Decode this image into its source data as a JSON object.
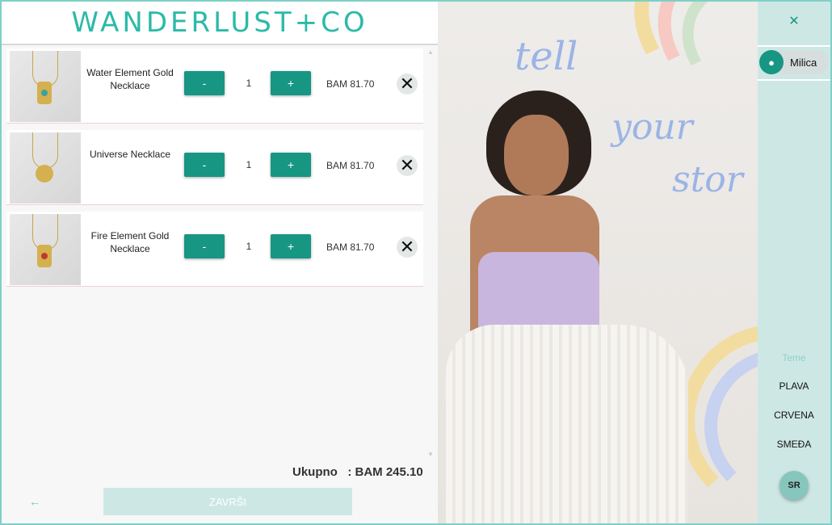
{
  "header": {
    "logo": "WANDERLUST+CO"
  },
  "cart": {
    "items": [
      {
        "name": "Water Element Gold Necklace",
        "quantity": "1",
        "price": "BAM 81.70",
        "minus": "-",
        "plus": "+",
        "gem_color": "#3aa1a0"
      },
      {
        "name": "Universe Necklace",
        "quantity": "1",
        "price": "BAM 81.70",
        "minus": "-",
        "plus": "+",
        "gem_color": "#d4b04f"
      },
      {
        "name": "Fire Element Gold Necklace",
        "quantity": "1",
        "price": "BAM 81.70",
        "minus": "-",
        "plus": "+",
        "gem_color": "#c0392b"
      }
    ],
    "total_label": "Ukupno",
    "total_value": ": BAM 245.10",
    "finish_label": "ZAVRŠI",
    "back_icon": "←",
    "remove_icon": "✕"
  },
  "hero_image": {
    "script_lines": [
      "tell",
      "your",
      "stor"
    ]
  },
  "sidebar": {
    "close_icon": "✕",
    "user_name": "Milica",
    "user_icon": "person-icon",
    "themes_title": "Teme",
    "themes": [
      "PLAVA",
      "CRVENA",
      "SMEĐA"
    ],
    "language": "SR"
  },
  "colors": {
    "accent": "#179684",
    "logo": "#2bbaa7",
    "sidebar": "#cde8e4",
    "border": "#7fd0c6"
  }
}
